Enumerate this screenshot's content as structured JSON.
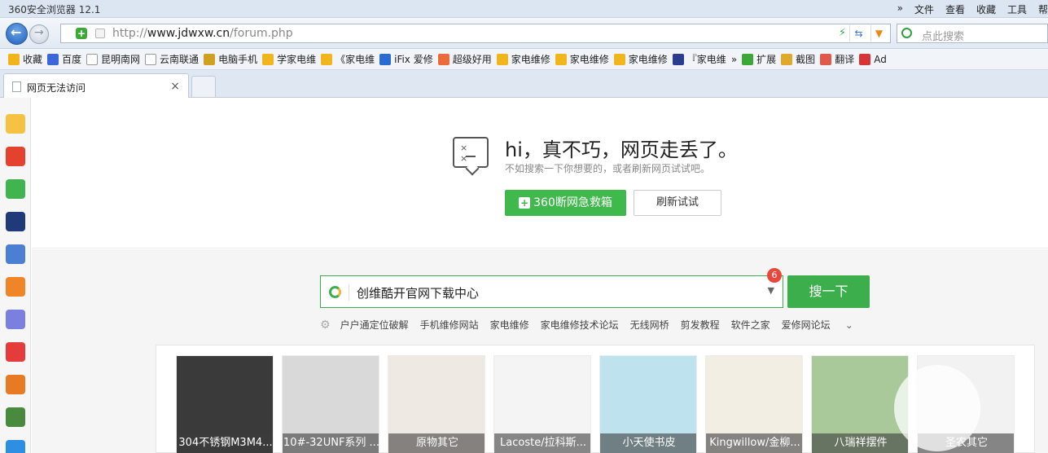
{
  "window": {
    "title": "360安全浏览器 12.1",
    "menus": [
      "»",
      "文件",
      "查看",
      "收藏",
      "工具",
      "帮"
    ]
  },
  "address": {
    "url_scheme": "http://",
    "url_host": "www.jdwxw.cn",
    "url_path": "/forum.php",
    "search_placeholder": "点此搜索"
  },
  "bookmarks": [
    {
      "label": "收藏",
      "icon": "star-icon",
      "color": "#f3b41b"
    },
    {
      "label": "百度",
      "icon": "baidu-paw-icon",
      "color": "#3b67d8"
    },
    {
      "label": "昆明南网",
      "icon": "page-icon",
      "color": "#ffffff"
    },
    {
      "label": "云南联通",
      "icon": "page-icon",
      "color": "#ffffff"
    },
    {
      "label": "电脑手机",
      "icon": "site-icon",
      "color": "#d0a020"
    },
    {
      "label": "学家电维",
      "icon": "site-icon",
      "color": "#f1b51d"
    },
    {
      "label": "《家电维",
      "icon": "site-icon",
      "color": "#f1b51d"
    },
    {
      "label": "iFix 爱修",
      "icon": "ifix-icon",
      "color": "#2a6bd1"
    },
    {
      "label": "超级好用",
      "icon": "site-icon",
      "color": "#ea6a3a"
    },
    {
      "label": "家电维修",
      "icon": "site-icon",
      "color": "#f1b51d"
    },
    {
      "label": "家电维修",
      "icon": "site-icon",
      "color": "#f1b51d"
    },
    {
      "label": "家电维修",
      "icon": "site-icon",
      "color": "#f1b51d"
    },
    {
      "label": "『家电维",
      "icon": "site-icon",
      "color": "#2c3d8f"
    },
    {
      "label": "»",
      "icon": "",
      "color": ""
    },
    {
      "label": "扩展",
      "icon": "extensions-icon",
      "color": "#3aa936"
    },
    {
      "label": "截图",
      "icon": "screenshot-icon",
      "color": "#e0a92e"
    },
    {
      "label": "翻译",
      "icon": "translate-icon",
      "color": "#e05a4b"
    },
    {
      "label": "Ad",
      "icon": "adblock-icon",
      "color": "#d63535"
    }
  ],
  "tab": {
    "label": "网页无法访问",
    "close": "×"
  },
  "error": {
    "title": "hi，真不巧，网页走丢了。",
    "subtitle": "不如搜索一下你想要的，或者刷新网页试试吧。",
    "rescue_button": "360断网急救箱",
    "refresh_button": "刷新试试"
  },
  "search": {
    "value": "创维酷开官网下载中心",
    "badge": "6",
    "button": "搜一下",
    "hotwords": [
      "户户通定位破解",
      "手机维修网站",
      "家电维修",
      "家电维修技术论坛",
      "无线网桥",
      "剪发教程",
      "软件之家",
      "爱修网论坛"
    ]
  },
  "products": [
    {
      "caption": "304不锈钢M3M4...",
      "bg": "#3a3a3a"
    },
    {
      "caption": "10#-32UNF系列 ...",
      "bg": "#d9d9d9"
    },
    {
      "caption": "原物其它",
      "bg": "#efe9e3"
    },
    {
      "caption": "Lacoste/拉科斯...",
      "bg": "#f4f4f4"
    },
    {
      "caption": "小天使书皮",
      "bg": "#bfe3ee"
    },
    {
      "caption": "Kingwillow/金柳...",
      "bg": "#f3eee4"
    },
    {
      "caption": "八瑞祥摆件",
      "bg": "#a9c99a"
    },
    {
      "caption": "圣农其它",
      "bg": "#f2f2f2"
    }
  ],
  "sidebar": [
    {
      "name": "favorites-star-icon",
      "color": "#f6c244"
    },
    {
      "name": "weibo-icon",
      "color": "#e5412f"
    },
    {
      "name": "mail-icon",
      "color": "#3fb44f"
    },
    {
      "name": "global-news-icon",
      "color": "#1f3a7a"
    },
    {
      "name": "document-icon",
      "color": "#4a7fd4"
    },
    {
      "name": "free-novel-icon",
      "color": "#f08428"
    },
    {
      "name": "game-icon",
      "color": "#7a7fe0"
    },
    {
      "name": "xiaohongshu-icon",
      "color": "#e43b3b"
    },
    {
      "name": "game2-icon",
      "color": "#e77a22"
    },
    {
      "name": "game3-icon",
      "color": "#4a8a3e"
    },
    {
      "name": "app-icon",
      "color": "#2d8fe3"
    }
  ]
}
